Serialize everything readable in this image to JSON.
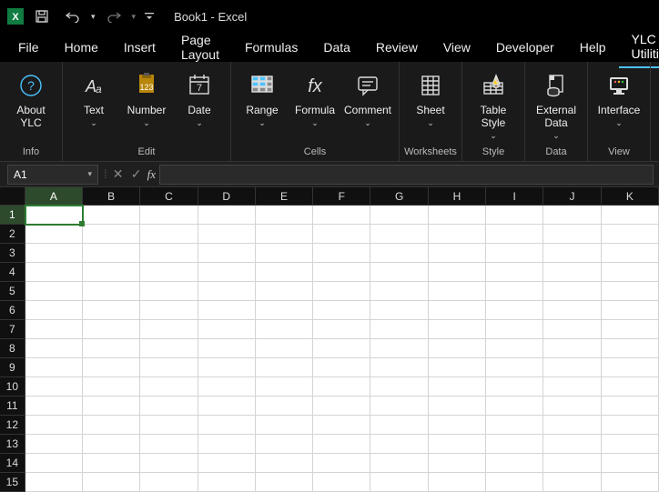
{
  "title": {
    "text": "Book1  -  Excel"
  },
  "tabs": [
    "File",
    "Home",
    "Insert",
    "Page Layout",
    "Formulas",
    "Data",
    "Review",
    "View",
    "Developer",
    "Help",
    "YLC Utilities"
  ],
  "active_tab": "YLC Utilities",
  "ribbon": {
    "groups": [
      {
        "label": "Info",
        "buttons": [
          {
            "key": "about",
            "label": "About YLC",
            "drop": false
          }
        ]
      },
      {
        "label": "Edit",
        "buttons": [
          {
            "key": "text",
            "label": "Text",
            "drop": true
          },
          {
            "key": "number",
            "label": "Number",
            "drop": true
          },
          {
            "key": "date",
            "label": "Date",
            "drop": true
          }
        ]
      },
      {
        "label": "Cells",
        "buttons": [
          {
            "key": "range",
            "label": "Range",
            "drop": true
          },
          {
            "key": "formula",
            "label": "Formula",
            "drop": true
          },
          {
            "key": "comment",
            "label": "Comment",
            "drop": true
          }
        ]
      },
      {
        "label": "Worksheets",
        "buttons": [
          {
            "key": "sheet",
            "label": "Sheet",
            "drop": true
          }
        ]
      },
      {
        "label": "Style",
        "buttons": [
          {
            "key": "tablestyle",
            "label": "Table Style",
            "drop": true
          }
        ]
      },
      {
        "label": "Data",
        "buttons": [
          {
            "key": "extdata",
            "label": "External Data",
            "drop": true
          }
        ]
      },
      {
        "label": "View",
        "buttons": [
          {
            "key": "interface",
            "label": "Interface",
            "drop": true
          }
        ]
      }
    ]
  },
  "namebox": {
    "value": "A1"
  },
  "formula": {
    "value": ""
  },
  "grid": {
    "cols": [
      "A",
      "B",
      "C",
      "D",
      "E",
      "F",
      "G",
      "H",
      "I",
      "J",
      "K"
    ],
    "rows": [
      "1",
      "2",
      "3",
      "4",
      "5",
      "6",
      "7",
      "8",
      "9",
      "10",
      "11",
      "12",
      "13",
      "14",
      "15"
    ],
    "selected": "A1"
  }
}
